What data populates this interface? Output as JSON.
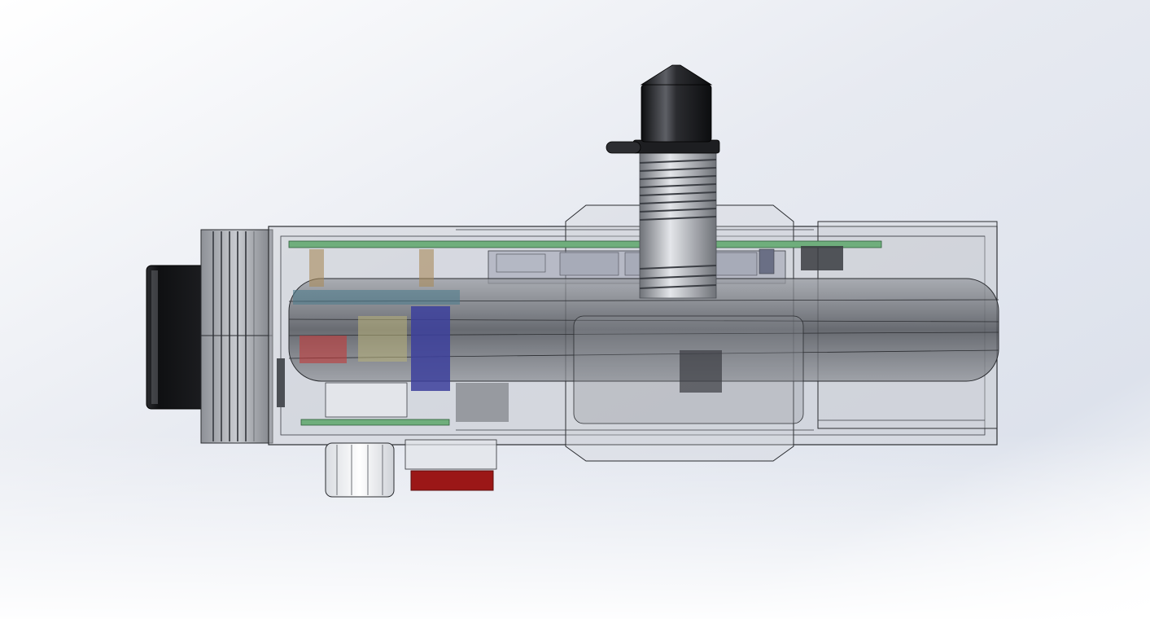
{
  "scene": {
    "kind": "cad-render",
    "subject": "translucent-enclosure-assembly",
    "colors": {
      "background_top": "#dde2ec",
      "background_bottom": "#ffffff",
      "housing_fill": "#c9ccd2",
      "housing_edge": "#2b2d31",
      "pcb_green": "#6fae7c",
      "nozzle_black": "#16171a",
      "thread_silver": "#b9bcc2",
      "knob_white": "#eef0f3",
      "button_red": "#9b1717",
      "battery_blue": "#3c3f9c",
      "lens_black": "#111214",
      "rod_dark": "#55585e"
    },
    "icons": [
      "nozzle-icon",
      "lens-icon",
      "knob-icon",
      "button-icon"
    ]
  }
}
